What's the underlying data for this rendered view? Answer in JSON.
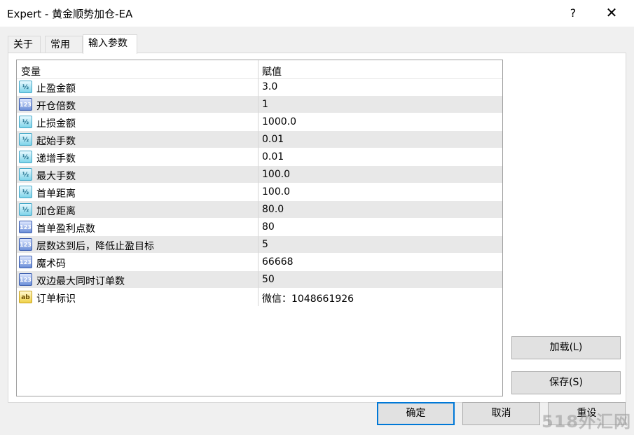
{
  "window": {
    "title": "Expert - 黄金顺势加仓-EA",
    "help_glyph": "?",
    "close_glyph": "✕"
  },
  "tabs": [
    {
      "label": "关于",
      "active": false
    },
    {
      "label": "常用",
      "active": false
    },
    {
      "label": "输入参数",
      "active": true
    }
  ],
  "table": {
    "columns": [
      "变量",
      "赋值"
    ],
    "rows": [
      {
        "type": "double",
        "icon_text": "½",
        "name": "止盈金额",
        "value": "3.0"
      },
      {
        "type": "int",
        "icon_text": "123",
        "name": "开仓倍数",
        "value": "1"
      },
      {
        "type": "double",
        "icon_text": "½",
        "name": "止损金额",
        "value": "1000.0"
      },
      {
        "type": "double",
        "icon_text": "½",
        "name": "起始手数",
        "value": "0.01"
      },
      {
        "type": "double",
        "icon_text": "½",
        "name": "递增手数",
        "value": "0.01"
      },
      {
        "type": "double",
        "icon_text": "½",
        "name": "最大手数",
        "value": "100.0"
      },
      {
        "type": "double",
        "icon_text": "½",
        "name": "首单距离",
        "value": "100.0"
      },
      {
        "type": "double",
        "icon_text": "½",
        "name": "加仓距离",
        "value": "80.0"
      },
      {
        "type": "int",
        "icon_text": "123",
        "name": "首单盈利点数",
        "value": "80"
      },
      {
        "type": "int",
        "icon_text": "123",
        "name": "层数达到后，降低止盈目标",
        "value": "5"
      },
      {
        "type": "int",
        "icon_text": "123",
        "name": "魔术码",
        "value": "66668"
      },
      {
        "type": "int",
        "icon_text": "123",
        "name": "双边最大同时订单数",
        "value": "50"
      },
      {
        "type": "string",
        "icon_text": "ab",
        "name": "订单标识",
        "value": "微信：1048661926"
      }
    ]
  },
  "buttons": {
    "load": "加载(L)",
    "save": "保存(S)",
    "ok": "确定",
    "cancel": "取消",
    "reset": "重设"
  },
  "watermark": "518外汇网",
  "colors": {
    "accent": "#0078d7",
    "row_alt": "#e8e8e8",
    "dialog_bg": "#f0f0f0"
  }
}
